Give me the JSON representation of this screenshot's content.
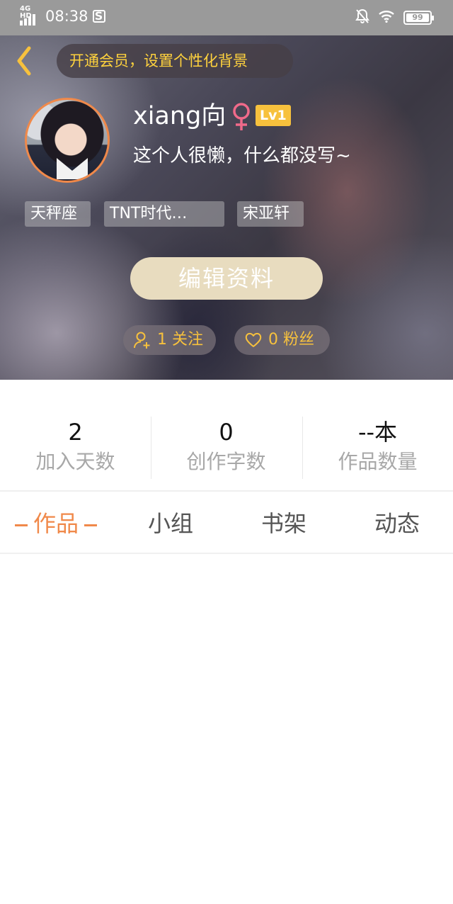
{
  "status_bar": {
    "network": "4G HD",
    "time": "08:38",
    "extra_icon": "S",
    "battery": "99"
  },
  "header": {
    "vip_banner": "开通会员，设置个性化背景",
    "username": "xiang向",
    "gender_icon": "female-icon",
    "level": "Lv1",
    "bio": "这个人很懒，什么都没写~",
    "tags": [
      "天秤座",
      "TNT时代…",
      "宋亚轩"
    ],
    "edit_button": "编辑资料",
    "follow": "1 关注",
    "fans": "0 粉丝",
    "colors": {
      "accent": "#f7c13d",
      "avatar_border": "#f0894a",
      "edit_button_bg": "#e8dcbf"
    }
  },
  "stats": [
    {
      "value": "2",
      "label": "加入天数"
    },
    {
      "value": "0",
      "label": "创作字数"
    },
    {
      "value": "--本",
      "label": "作品数量"
    }
  ],
  "tabs": [
    {
      "label": "作品",
      "active": true
    },
    {
      "label": "小组",
      "active": false
    },
    {
      "label": "书架",
      "active": false
    },
    {
      "label": "动态",
      "active": false
    }
  ],
  "colors": {
    "active_tab": "#f0894a",
    "stat_label": "#a8a8a8"
  }
}
